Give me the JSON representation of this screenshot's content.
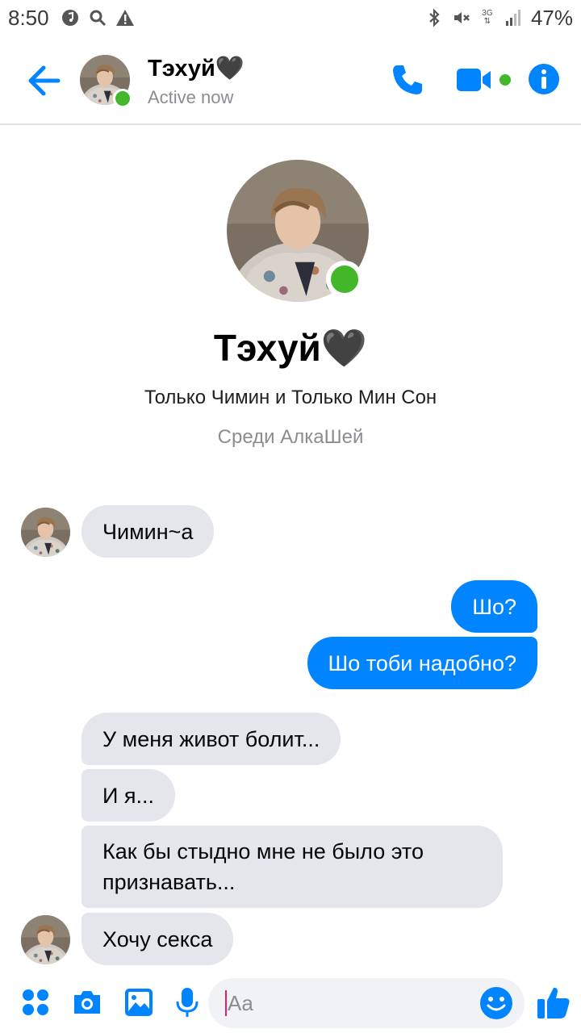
{
  "status_bar": {
    "time": "8:50",
    "battery": "47%",
    "network": "3G",
    "left_icons": [
      "music-icon",
      "search-icon",
      "warning-icon"
    ],
    "right_icons": [
      "bluetooth-icon",
      "mute-icon",
      "network-3g-icon",
      "signal-icon"
    ]
  },
  "header": {
    "name": "Тэхуй🖤",
    "status": "Active now"
  },
  "profile": {
    "name": "Тэхуй🖤",
    "subtitle": "Только Чимин и Только Мин Сон",
    "group": "Среди АлкаШей"
  },
  "messages": [
    {
      "dir": "in",
      "text": "Чимин~а"
    },
    {
      "dir": "out",
      "text": "Шо?"
    },
    {
      "dir": "out",
      "text": "Шо тоби надобно?"
    },
    {
      "dir": "in",
      "text": "У меня живот болит..."
    },
    {
      "dir": "in",
      "text": "И я..."
    },
    {
      "dir": "in",
      "text": "Как бы стыдно мне не было это признавать..."
    },
    {
      "dir": "in",
      "text": "Хочу секса"
    }
  ],
  "composer": {
    "placeholder": "Aa"
  },
  "colors": {
    "accent": "#0084ff",
    "online": "#42b72a",
    "incoming_bubble": "#e4e6eb"
  }
}
